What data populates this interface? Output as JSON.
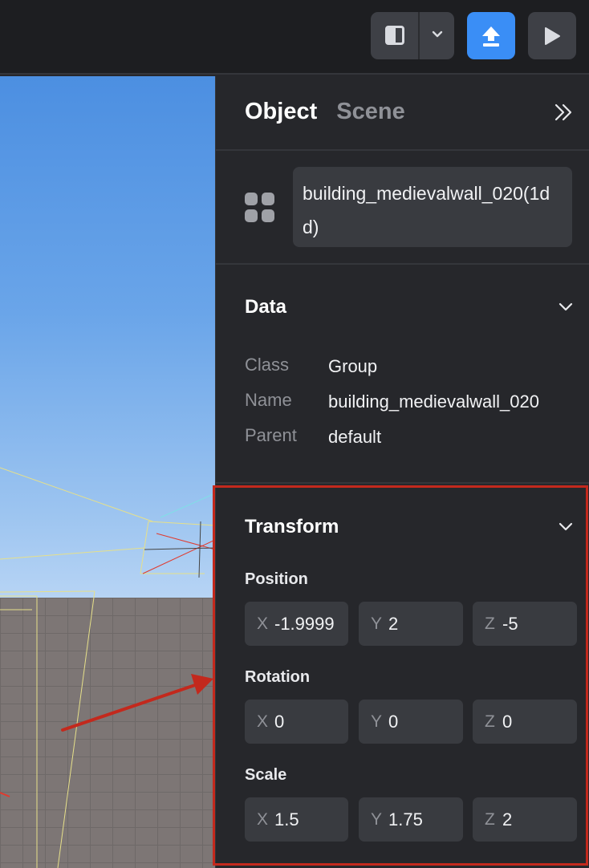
{
  "toolbar": {
    "buttons": [
      {
        "name": "layout-toggle-button",
        "icon": "panel-layout-icon"
      },
      {
        "name": "layout-dropdown-button",
        "icon": "chevron-down-icon"
      },
      {
        "name": "publish-button",
        "icon": "upload-icon"
      },
      {
        "name": "play-button",
        "icon": "play-icon"
      }
    ],
    "accent_color": "#3a8ef6"
  },
  "panel": {
    "tabs": [
      {
        "label": "Object",
        "active": true
      },
      {
        "label": "Scene",
        "active": false
      }
    ],
    "object_name": "building_medievalwall_020(1dd)",
    "data_section": {
      "title": "Data",
      "rows": [
        {
          "key": "Class",
          "value": "Group"
        },
        {
          "key": "Name",
          "value": "building_medievalwall_020"
        },
        {
          "key": "Parent",
          "value": "default"
        }
      ]
    },
    "transform_section": {
      "title": "Transform",
      "position": {
        "label": "Position",
        "x": "-1.9999",
        "y": "2",
        "z": "-5"
      },
      "rotation": {
        "label": "Rotation",
        "x": "0",
        "y": "0",
        "z": "0"
      },
      "scale": {
        "label": "Scale",
        "x": "1.5",
        "y": "1.75",
        "z": "2"
      },
      "axis_labels": {
        "x": "X",
        "y": "Y",
        "z": "Z"
      }
    }
  },
  "annotation": {
    "highlight_color": "#c3291d"
  }
}
